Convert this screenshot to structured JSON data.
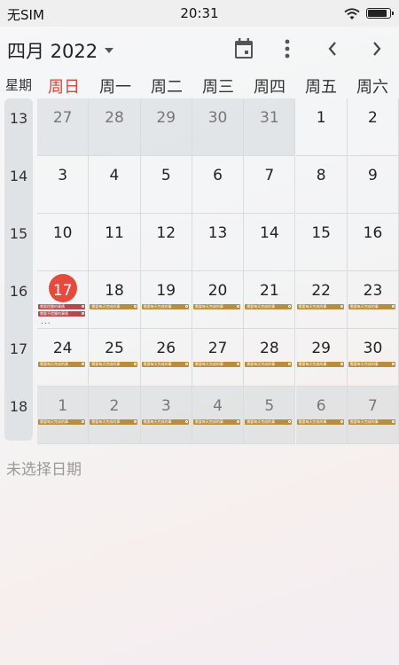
{
  "status": {
    "carrier": "无SIM",
    "time": "20:31"
  },
  "header": {
    "title": "四月 2022"
  },
  "weekday_header": {
    "label": "星期",
    "days": [
      "周日",
      "周一",
      "周二",
      "周三",
      "周四",
      "周五",
      "周六"
    ]
  },
  "week_numbers": [
    "13",
    "14",
    "15",
    "16",
    "17",
    "18"
  ],
  "weeks": [
    [
      {
        "day": "27",
        "other": true
      },
      {
        "day": "28",
        "other": true
      },
      {
        "day": "29",
        "other": true
      },
      {
        "day": "30",
        "other": true
      },
      {
        "day": "31",
        "other": true
      },
      {
        "day": "1"
      },
      {
        "day": "2"
      }
    ],
    [
      {
        "day": "3"
      },
      {
        "day": "4"
      },
      {
        "day": "5"
      },
      {
        "day": "6"
      },
      {
        "day": "7"
      },
      {
        "day": "8"
      },
      {
        "day": "9"
      }
    ],
    [
      {
        "day": "10"
      },
      {
        "day": "11"
      },
      {
        "day": "12"
      },
      {
        "day": "13"
      },
      {
        "day": "14"
      },
      {
        "day": "15"
      },
      {
        "day": "16"
      }
    ],
    [
      {
        "day": "17",
        "today": true,
        "events": [
          {
            "text": "需要提醒的事情",
            "color": "red"
          },
          {
            "text": "需要不提醒的事情",
            "color": "red"
          }
        ],
        "more": "..."
      },
      {
        "day": "18",
        "events": [
          {
            "text": "需要每天完成的事",
            "color": "gold"
          }
        ]
      },
      {
        "day": "19",
        "events": [
          {
            "text": "需要每天完成的事",
            "color": "gold"
          }
        ]
      },
      {
        "day": "20",
        "events": [
          {
            "text": "需要每天完成的事",
            "color": "gold"
          }
        ]
      },
      {
        "day": "21",
        "events": [
          {
            "text": "需要每天完成的事",
            "color": "gold"
          }
        ]
      },
      {
        "day": "22",
        "events": [
          {
            "text": "需要每天完成的事",
            "color": "gold"
          }
        ]
      },
      {
        "day": "23",
        "events": [
          {
            "text": "需要每天完成的事",
            "color": "gold"
          }
        ]
      }
    ],
    [
      {
        "day": "24",
        "events": [
          {
            "text": "需要每天完成的事",
            "color": "gold"
          }
        ]
      },
      {
        "day": "25",
        "events": [
          {
            "text": "需要每天完成的事",
            "color": "gold"
          }
        ]
      },
      {
        "day": "26",
        "events": [
          {
            "text": "需要每天完成的事",
            "color": "gold"
          }
        ]
      },
      {
        "day": "27",
        "events": [
          {
            "text": "需要每天完成的事",
            "color": "gold"
          }
        ]
      },
      {
        "day": "28",
        "events": [
          {
            "text": "需要每天完成的事",
            "color": "gold"
          }
        ]
      },
      {
        "day": "29",
        "events": [
          {
            "text": "需要每天完成的事",
            "color": "gold"
          }
        ]
      },
      {
        "day": "30",
        "events": [
          {
            "text": "需要每天完成的事",
            "color": "gold"
          }
        ]
      }
    ],
    [
      {
        "day": "1",
        "other": true,
        "events": [
          {
            "text": "需要每天完成的事",
            "color": "gold"
          }
        ]
      },
      {
        "day": "2",
        "other": true,
        "events": [
          {
            "text": "需要每天完成的事",
            "color": "gold"
          }
        ]
      },
      {
        "day": "3",
        "other": true,
        "events": [
          {
            "text": "需要每天完成的事",
            "color": "gold"
          }
        ]
      },
      {
        "day": "4",
        "other": true,
        "events": [
          {
            "text": "需要每天完成的事",
            "color": "gold"
          }
        ]
      },
      {
        "day": "5",
        "other": true,
        "events": [
          {
            "text": "需要每天完成的事",
            "color": "gold"
          }
        ]
      },
      {
        "day": "6",
        "other": true,
        "events": [
          {
            "text": "需要每天完成的事",
            "color": "gold"
          }
        ]
      },
      {
        "day": "7",
        "other": true,
        "events": [
          {
            "text": "需要每天完成的事",
            "color": "gold"
          }
        ]
      }
    ]
  ],
  "empty_message": "未选择日期",
  "colors": {
    "accent_today": "#e54b3c",
    "sunday": "#d9443a",
    "event_gold": "#b98d3b",
    "event_red": "#b8494a"
  },
  "icons": {
    "calendar": "calendar-today-icon",
    "menu": "more-vert-icon",
    "prev": "chevron-left-icon",
    "next": "chevron-right-icon"
  }
}
